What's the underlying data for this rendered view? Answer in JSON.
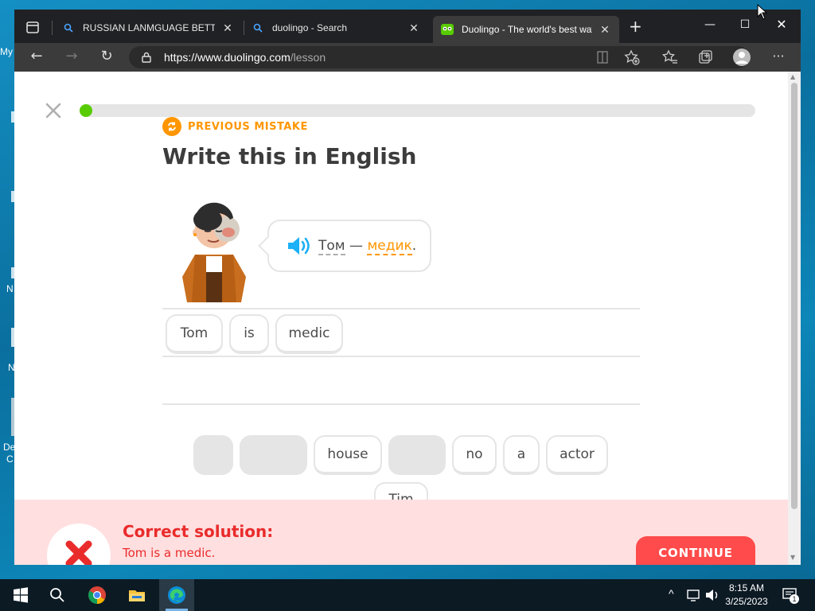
{
  "desktop": {
    "icon_labels": [
      "My",
      "N",
      "N",
      "De",
      "C"
    ]
  },
  "browser": {
    "tabs": [
      {
        "title": "RUSSIAN LANMGUAGE BETTER",
        "active": false
      },
      {
        "title": "duolingo - Search",
        "active": false
      },
      {
        "title": "Duolingo - The world's best way",
        "active": true
      }
    ],
    "url_host": "https://www.duolingo.com",
    "url_path": "/lesson"
  },
  "lesson": {
    "progress": 0.01,
    "previous_mistake_label": "PREVIOUS MISTAKE",
    "heading": "Write this in English",
    "prompt": {
      "word1": "Том",
      "dash": " — ",
      "word2": "медик",
      "period": "."
    },
    "answer_chips": [
      "Tom",
      "is",
      "medic"
    ],
    "word_bank": [
      {
        "text": "",
        "used": true
      },
      {
        "text": "",
        "used": true
      },
      {
        "text": "house",
        "used": false
      },
      {
        "text": "",
        "used": true
      },
      {
        "text": "no",
        "used": false
      },
      {
        "text": "a",
        "used": false
      },
      {
        "text": "actor",
        "used": false
      },
      {
        "text": "Tim",
        "used": false
      }
    ],
    "feedback": {
      "title": "Correct solution:",
      "text": "Tom is a medic.",
      "button": "CONTINUE"
    }
  },
  "taskbar": {
    "time": "8:15 AM",
    "date": "3/25/2023",
    "notification_count": "1"
  },
  "colors": {
    "duo_green": "#58cc02",
    "orange": "#ff9600",
    "error_red": "#ea2b2b",
    "feedback_bg": "#ffdfe0"
  }
}
